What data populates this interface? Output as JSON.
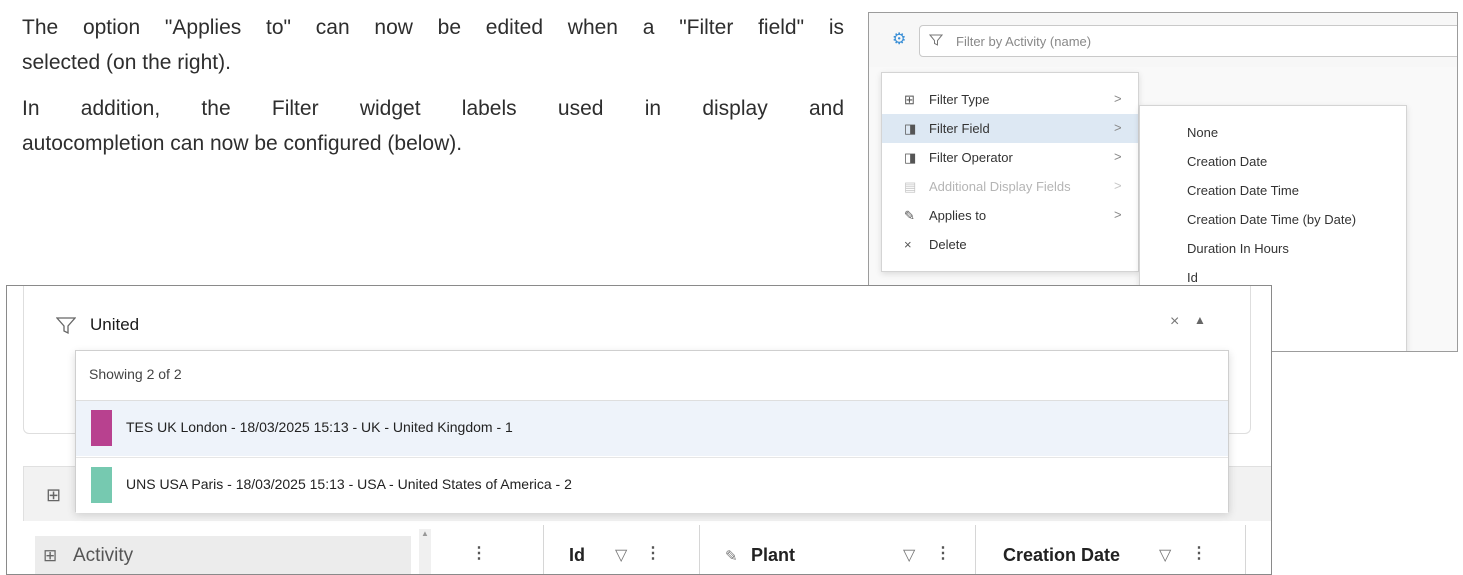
{
  "prose": {
    "line1": "The option \"Applies to\" can now be edited when a \"Filter field\" is",
    "line2": "selected (on the right).",
    "line3": "In addition, the Filter widget labels used in display and",
    "line4": "autocompletion can now be configured (below)."
  },
  "top_screenshot": {
    "filter_placeholder": "Filter by Activity (name)",
    "context_menu": [
      {
        "label": "Filter Type",
        "icon": "grid-icon",
        "state": "normal"
      },
      {
        "label": "Filter Field",
        "icon": "column-icon",
        "state": "active"
      },
      {
        "label": "Filter Operator",
        "icon": "column-icon",
        "state": "normal"
      },
      {
        "label": "Additional Display Fields",
        "icon": "list-icon",
        "state": "disabled"
      },
      {
        "label": "Applies to",
        "icon": "pin-icon",
        "state": "normal"
      },
      {
        "label": "Delete",
        "icon": "close-icon",
        "state": "normal"
      }
    ],
    "chevron": ">",
    "submenu": [
      "None",
      "Creation Date",
      "Creation Date Time",
      "Creation Date Time (by Date)",
      "Duration In Hours",
      "Id"
    ]
  },
  "bottom_screenshot": {
    "filter_value": "United",
    "clear_glyph": "×",
    "collapse_glyph": "▲",
    "dropdown_header": "Showing 2 of 2",
    "results": [
      {
        "text": "TES UK London - 18/03/2025 15:13 - UK - United Kingdom - 1",
        "color": "#b8418f"
      },
      {
        "text": "UNS USA Paris - 18/03/2025 15:13 - USA - United States of America - 2",
        "color": "#76c9b0"
      }
    ],
    "left_panel_label": "Activity",
    "columns": [
      "Id",
      "Plant",
      "Creation Date"
    ],
    "menu_glyph": "⋮"
  }
}
